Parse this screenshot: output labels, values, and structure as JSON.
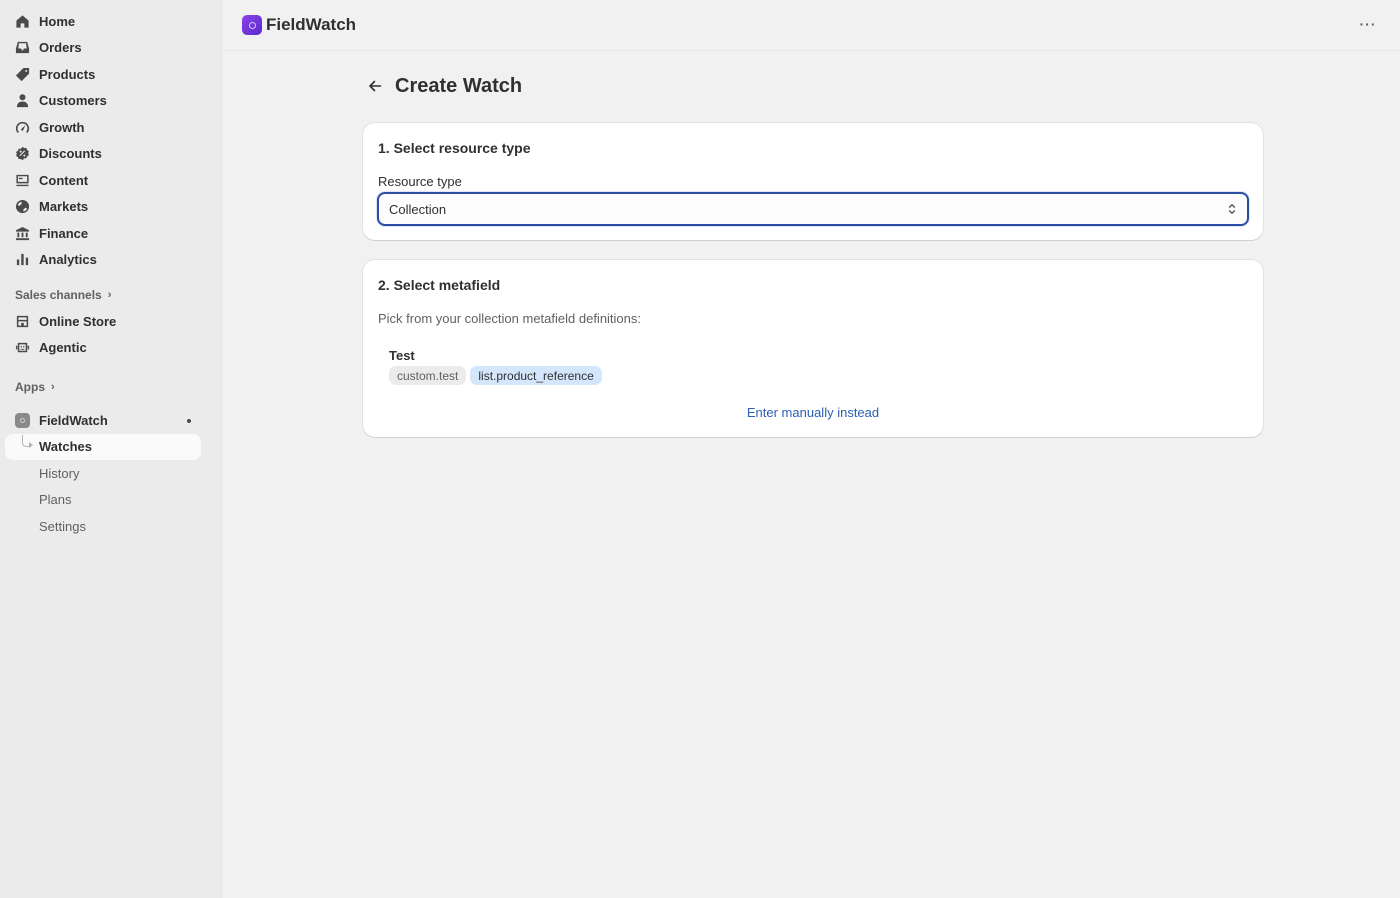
{
  "sidebar": {
    "items": [
      {
        "label": "Home",
        "icon": "home-icon"
      },
      {
        "label": "Orders",
        "icon": "inbox-icon"
      },
      {
        "label": "Products",
        "icon": "tag-icon"
      },
      {
        "label": "Customers",
        "icon": "person-icon"
      },
      {
        "label": "Growth",
        "icon": "gauge-icon"
      },
      {
        "label": "Discounts",
        "icon": "discount-icon"
      },
      {
        "label": "Content",
        "icon": "content-icon"
      },
      {
        "label": "Markets",
        "icon": "globe-icon"
      },
      {
        "label": "Finance",
        "icon": "bank-icon"
      },
      {
        "label": "Analytics",
        "icon": "bar-chart-icon"
      }
    ],
    "sales_channels": {
      "label": "Sales channels",
      "items": [
        {
          "label": "Online Store",
          "icon": "store-icon"
        },
        {
          "label": "Agentic",
          "icon": "robot-icon"
        }
      ]
    },
    "apps": {
      "label": "Apps",
      "app_name": "FieldWatch",
      "subitems": [
        "Watches",
        "History",
        "Plans",
        "Settings"
      ],
      "active": "Watches"
    }
  },
  "topbar": {
    "brand": "FieldWatch",
    "more": "···"
  },
  "page": {
    "title": "Create Watch"
  },
  "step1": {
    "title": "1. Select resource type",
    "field_label": "Resource type",
    "selected": "Collection"
  },
  "step2": {
    "title": "2. Select metafield",
    "description": "Pick from your collection metafield definitions:",
    "metafield": {
      "name": "Test",
      "key": "custom.test",
      "type": "list.product_reference"
    },
    "manual_link": "Enter manually instead"
  },
  "colors": {
    "accent": "#2b4ea3",
    "link": "#2c5fb4",
    "brand": "#7a3be0"
  }
}
